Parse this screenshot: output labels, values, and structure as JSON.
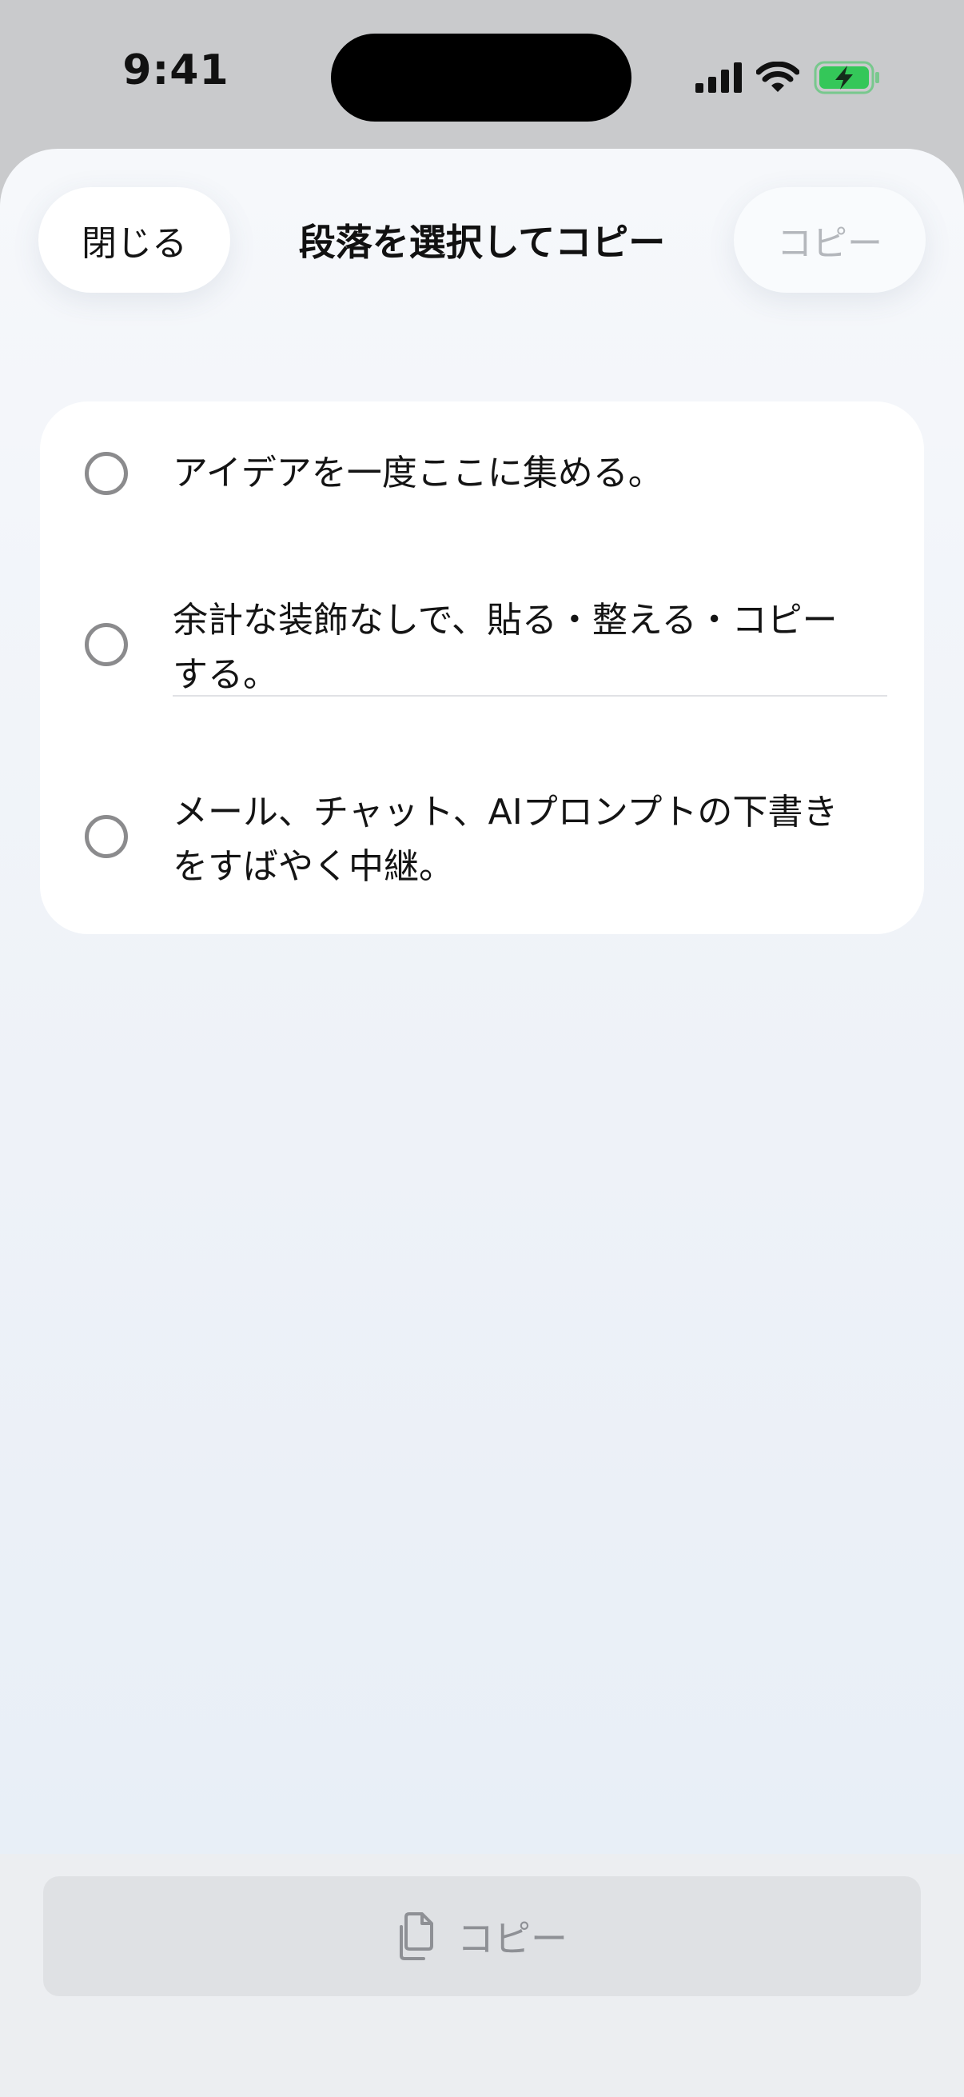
{
  "status_bar": {
    "time": "9:41"
  },
  "header": {
    "close_label": "閉じる",
    "title": "段落を選択してコピー",
    "copy_label": "コピー"
  },
  "paragraphs": [
    {
      "text": "アイデアを一度ここに集める。",
      "selected": false
    },
    {
      "text": "余計な装飾なしで、貼る・整える・コピーする。",
      "selected": false
    },
    {
      "text": "メール、チャット、AIプロンプトの下書きをすばやく中継。",
      "selected": false
    }
  ],
  "footer": {
    "copy_label": "コピー"
  },
  "icons": {
    "signal": "cellular-signal-icon",
    "wifi": "wifi-icon",
    "battery": "battery-charging-icon",
    "copy": "copy-documents-icon",
    "radio": "radio-empty-icon"
  },
  "colors": {
    "battery_green": "#34c759",
    "disabled_text": "#b4b7bc"
  }
}
